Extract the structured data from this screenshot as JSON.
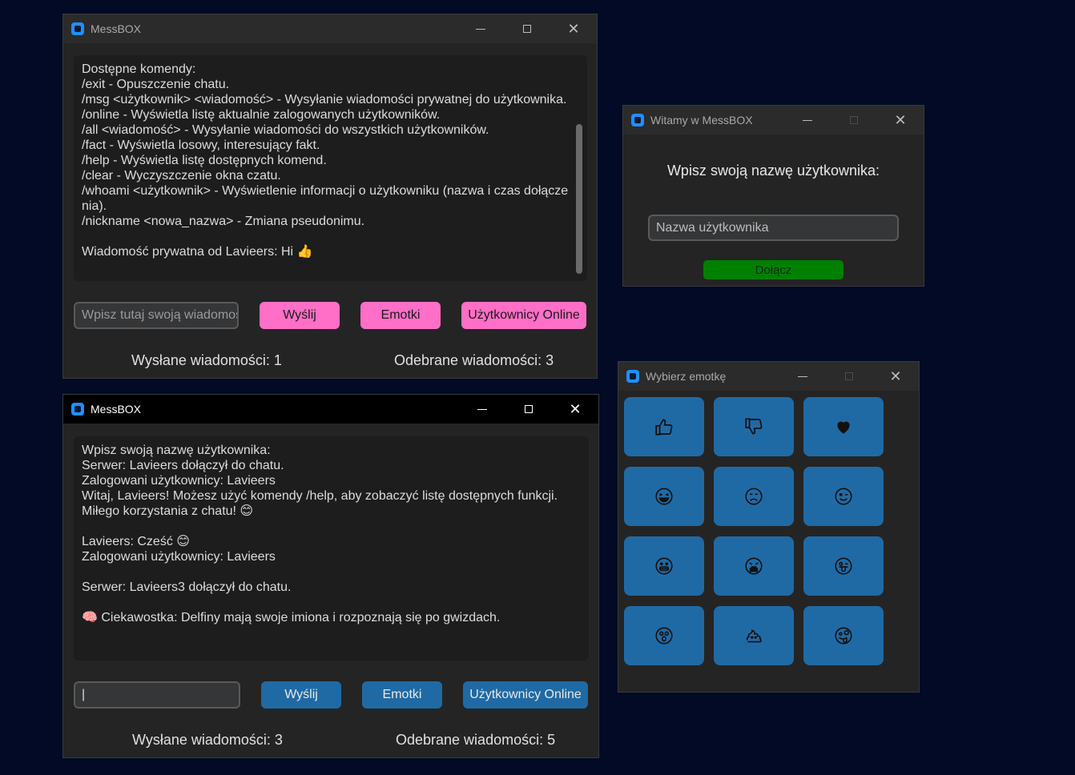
{
  "window_main1": {
    "title": "MessBOX",
    "chat_text": "Dostępne komendy:\n/exit - Opuszczenie chatu.\n/msg <użytkownik> <wiadomość> - Wysyłanie wiadomości prywatnej do użytkownika.\n/online - Wyświetla listę aktualnie zalogowanych użytkowników.\n/all <wiadomość> - Wysyłanie wiadomości do wszystkich użytkowników.\n/fact - Wyświetla losowy, interesujący fakt.\n/help - Wyświetla listę dostępnych komend.\n/clear - Wyczyszczenie okna czatu.\n/whoami <użytkownik> - Wyświetlenie informacji o użytkowniku (nazwa i czas dołącze\nnia).\n/nickname <nowa_nazwa> - Zmiana pseudonimu.\n\nWiadomość prywatna od Lavieers: Hi 👍",
    "input_placeholder": "Wpisz tutaj swoją wiadomość",
    "send_label": "Wyślij",
    "emotes_label": "Emotki",
    "online_label": "Użytkownicy Online",
    "sent_counter": "Wysłane wiadomości: 1",
    "received_counter": "Odebrane wiadomości: 3",
    "accent": "#ff6ec7"
  },
  "window_main2": {
    "title": "MessBOX",
    "chat_text": "Wpisz swoją nazwę użytkownika:\nSerwer: Lavieers dołączył do chatu.\nZalogowani użytkownicy: Lavieers\nWitaj, Lavieers! Możesz użyć komendy /help, aby zobaczyć listę dostępnych funkcji.\nMiłego korzystania z chatu! 😊\n\nLavieers: Cześć 😊\nZalogowani użytkownicy: Lavieers\n\nSerwer: Lavieers3 dołączył do chatu.\n\n🧠 Ciekawostka: Delfiny mają swoje imiona i rozpoznają się po gwizdach.",
    "input_value": "|",
    "send_label": "Wyślij",
    "emotes_label": "Emotki",
    "online_label": "Użytkownicy Online",
    "sent_counter": "Wysłane wiadomości: 3",
    "received_counter": "Odebrane wiadomości: 5",
    "accent": "#1f6aa5"
  },
  "window_login": {
    "title": "Witamy w MessBOX",
    "prompt": "Wpisz swoją nazwę użytkownika:",
    "username_placeholder": "Nazwa użytkownika",
    "join_label": "Dołącz",
    "join_color": "#008000"
  },
  "window_emoji": {
    "title": "Wybierz emotkę",
    "emojis": [
      {
        "icon": "thumbs-up-icon"
      },
      {
        "icon": "thumbs-down-icon"
      },
      {
        "icon": "heart-icon"
      },
      {
        "icon": "laughing-tears-icon"
      },
      {
        "icon": "sad-face-icon"
      },
      {
        "icon": "winking-face-icon"
      },
      {
        "icon": "grinning-face-icon"
      },
      {
        "icon": "crying-face-icon"
      },
      {
        "icon": "tongue-wink-face-icon"
      },
      {
        "icon": "surprised-face-icon"
      },
      {
        "icon": "poop-icon"
      },
      {
        "icon": "zany-face-icon"
      }
    ]
  }
}
